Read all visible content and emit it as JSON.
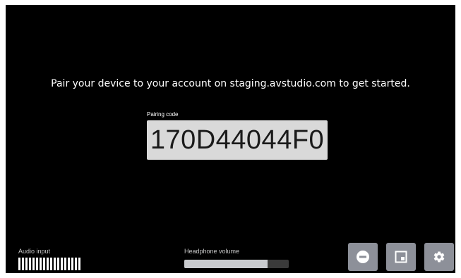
{
  "main": {
    "instruction": "Pair your device to your account on staging.avstudio.com to get started.",
    "pairing_label": "Pairing code",
    "pairing_code": "170D44044F0"
  },
  "footer": {
    "audio_input_label": "Audio input",
    "audio_input_bar_count": 18,
    "headphone_volume_label": "Headphone volume",
    "headphone_volume_level": 0.8,
    "buttons": [
      {
        "name": "mute-button",
        "icon": "minus-circle-icon"
      },
      {
        "name": "picture-in-picture-button",
        "icon": "picture-in-picture-icon"
      },
      {
        "name": "settings-button",
        "icon": "gear-icon"
      }
    ]
  },
  "colors": {
    "background": "#000000",
    "text": "#ffffff",
    "code_box": "#d9d9d9",
    "button": "#8d9099",
    "volume_fill": "#c9cbcf"
  }
}
